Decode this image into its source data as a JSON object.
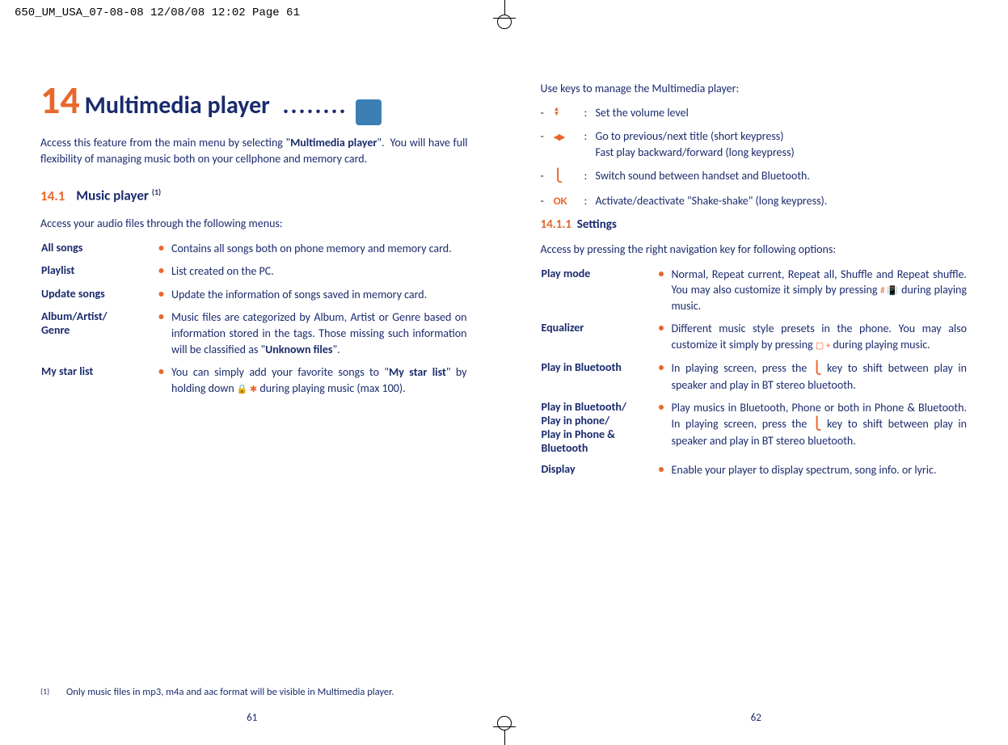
{
  "print_header": "650_UM_USA_07-08-08  12/08/08  12:02  Page 61",
  "left": {
    "chapter_number": "14",
    "chapter_title": "Multimedia player",
    "intro": "Access this feature from the main menu by selecting \"Multimedia player\".  You will have full flexibility of managing music both on your cellphone and memory card.",
    "section_number": "14.1",
    "section_title": "Music player",
    "section_sup": "(1)",
    "lead": "Access your audio files through the following menus:",
    "defs": [
      {
        "term": "All songs",
        "value": "Contains all songs both on phone memory and memory card."
      },
      {
        "term": "Playlist",
        "value": "List created on the PC."
      },
      {
        "term": "Update songs",
        "value": "Update the information of songs saved in memory card."
      },
      {
        "term": "Album/Artist/ Genre",
        "value_html": "Music files are categorized by Album, Artist or Genre based on information stored in the tags. Those missing such information will be classified as \"<span class='bold'>Unknown files</span>\"."
      },
      {
        "term": "My star list",
        "value_html": "You can simply add your favorite songs to \"<span class='bold'>My star list</span>\" by holding down <span class='inline-icon-orange'>🔒 ✱</span> during playing music (max 100)."
      }
    ],
    "footnote_marker": "(1)",
    "footnote": "Only music files in mp3, m4a and aac format will be visible in Multimedia player.",
    "page_number": "61"
  },
  "right": {
    "lead": "Use keys to manage the Multimedia player:",
    "keys": [
      {
        "icon": "updown",
        "desc": "Set the volume level"
      },
      {
        "icon": "leftright",
        "desc_html": "Go to previous/next title (short keypress)<br>Fast play backward/forward (long keypress)"
      },
      {
        "icon": "softkey",
        "desc": "Switch sound between handset and Bluetooth."
      },
      {
        "icon": "ok",
        "desc": "Activate/deactivate \"Shake-shake\" (long keypress)."
      }
    ],
    "sub_number": "14.1.1",
    "sub_title": "Settings",
    "sub_lead": "Access by pressing the right navigation key for following options:",
    "settings": [
      {
        "term": "Play mode",
        "value_html": "Normal, Repeat current, Repeat all, Shuffle and Repeat shuffle. You may also customize it simply by pressing <span class='inline-icon-orange'># 📳</span> during playing music."
      },
      {
        "term": "Equalizer",
        "value_html": "Different music style presets in the phone. You may also customize it simply by pressing <span class='inline-icon-orange'>▢ +</span> during playing music."
      },
      {
        "term": "Play in Bluetooth",
        "value_html": "In playing screen, press the <span class='soft-icon'>⎩</span> key to shift between play in speaker and play in BT stereo bluetooth."
      },
      {
        "term": "Play in Bluetooth/ Play in phone/ Play in Phone & Bluetooth",
        "value_html": "Play musics in Bluetooth, Phone or both in Phone & Bluetooth. In playing screen, press the <span class='soft-icon'>⎩</span> key to shift between play in speaker and play in BT stereo bluetooth."
      },
      {
        "term": "Display",
        "value": "Enable your player to display spectrum, song info. or lyric."
      }
    ],
    "page_number": "62"
  }
}
